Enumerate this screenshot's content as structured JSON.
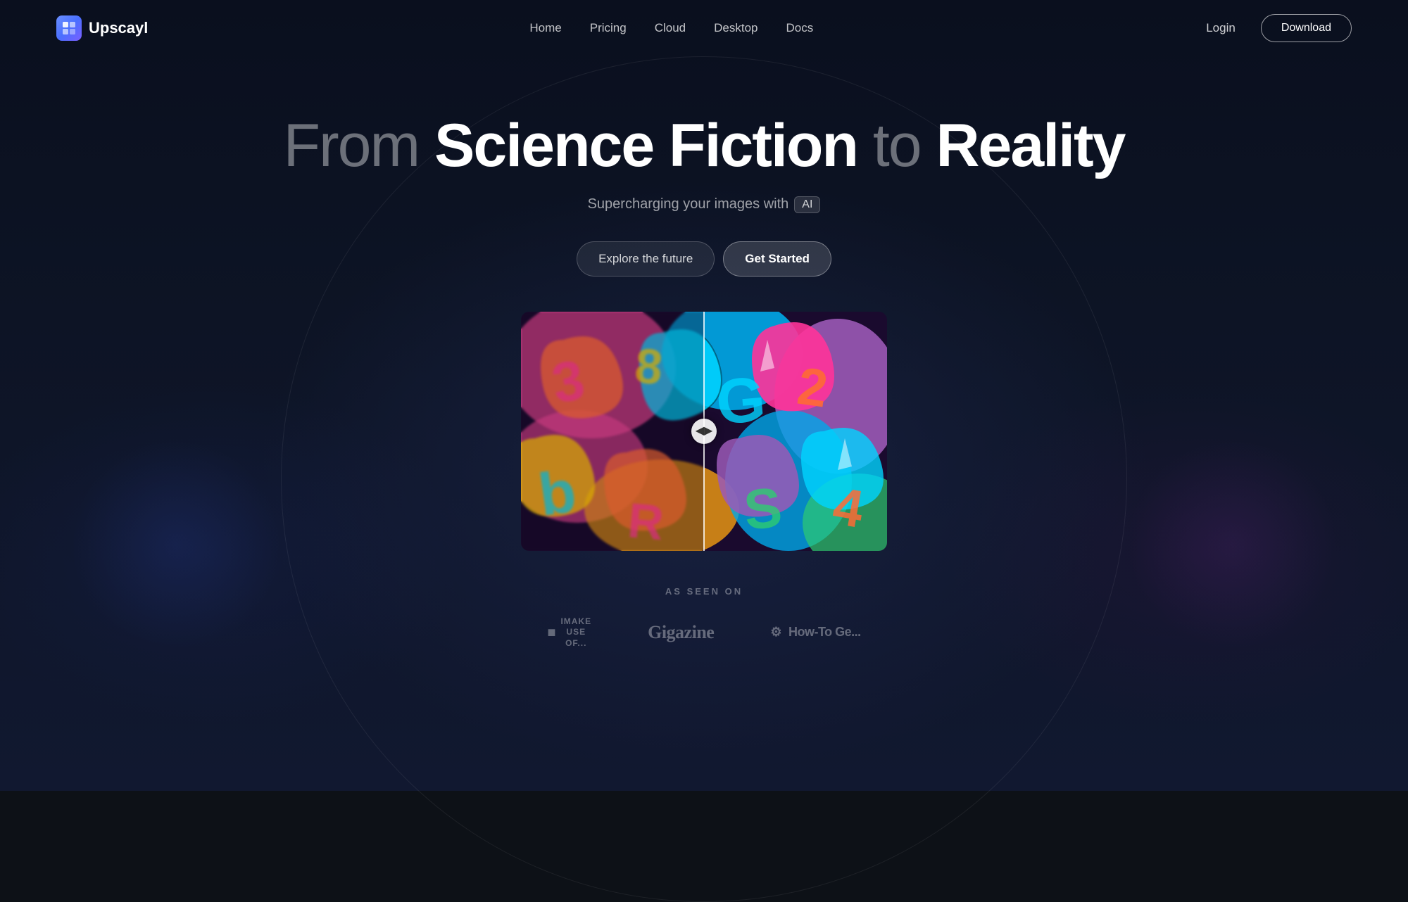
{
  "brand": {
    "name": "Upscayl",
    "logo_alt": "Upscayl logo"
  },
  "nav": {
    "links": [
      {
        "label": "Home",
        "href": "#"
      },
      {
        "label": "Pricing",
        "href": "#"
      },
      {
        "label": "Cloud",
        "href": "#"
      },
      {
        "label": "Desktop",
        "href": "#"
      },
      {
        "label": "Docs",
        "href": "#"
      }
    ],
    "login_label": "Login",
    "download_label": "Download"
  },
  "hero": {
    "title_from": "From",
    "title_science_fiction": "Science Fiction",
    "title_to": "to",
    "title_reality": "Reality",
    "subtitle_text": "Supercharging your images with",
    "subtitle_badge": "AI",
    "btn_explore": "Explore the future",
    "btn_get_started": "Get Started"
  },
  "as_seen_on": {
    "label": "AS SEEN ON",
    "brands": [
      {
        "name": "Make Use Of",
        "display": "iMAKE\nUSE\nOF..."
      },
      {
        "name": "Gigazine",
        "display": "Gigazine"
      },
      {
        "name": "How-To Geek",
        "display": "⚙ How-To Ge..."
      }
    ]
  }
}
